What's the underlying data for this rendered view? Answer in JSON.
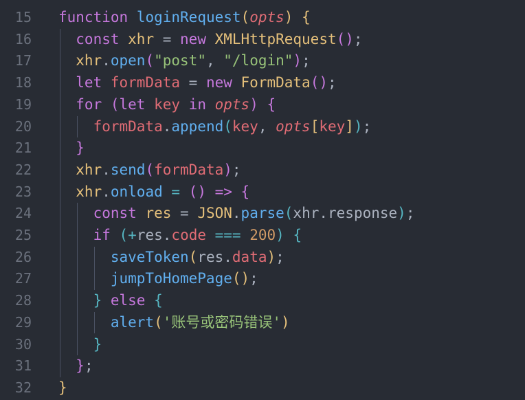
{
  "editor": {
    "lines": [
      {
        "num": "15",
        "tokens": [
          {
            "t": "function",
            "c": "kw"
          },
          {
            "t": " ",
            "c": "tx"
          },
          {
            "t": "loginRequest",
            "c": "fn"
          },
          {
            "t": "(",
            "c": "br"
          },
          {
            "t": "opts",
            "c": "pa"
          },
          {
            "t": ")",
            "c": "br"
          },
          {
            "t": " ",
            "c": "tx"
          },
          {
            "t": "{",
            "c": "br"
          }
        ]
      },
      {
        "num": "16",
        "tokens": [
          {
            "t": "  const ",
            "c": "kw"
          },
          {
            "t": "xhr",
            "c": "va"
          },
          {
            "t": " = ",
            "c": "tx"
          },
          {
            "t": "new ",
            "c": "kw"
          },
          {
            "t": "XMLHttpRequest",
            "c": "cl"
          },
          {
            "t": "()",
            "c": "pn"
          },
          {
            "t": ";",
            "c": "tx"
          }
        ]
      },
      {
        "num": "17",
        "tokens": [
          {
            "t": "  xhr",
            "c": "va"
          },
          {
            "t": ".",
            "c": "tx"
          },
          {
            "t": "open",
            "c": "fn"
          },
          {
            "t": "(",
            "c": "pn"
          },
          {
            "t": "\"post\"",
            "c": "st"
          },
          {
            "t": ", ",
            "c": "tx"
          },
          {
            "t": "\"/login\"",
            "c": "st"
          },
          {
            "t": ")",
            "c": "pn"
          },
          {
            "t": ";",
            "c": "tx"
          }
        ]
      },
      {
        "num": "18",
        "tokens": [
          {
            "t": "  let ",
            "c": "kw"
          },
          {
            "t": "formData",
            "c": "vr"
          },
          {
            "t": " = ",
            "c": "tx"
          },
          {
            "t": "new ",
            "c": "kw"
          },
          {
            "t": "FormData",
            "c": "cl"
          },
          {
            "t": "()",
            "c": "pn"
          },
          {
            "t": ";",
            "c": "tx"
          }
        ]
      },
      {
        "num": "19",
        "tokens": [
          {
            "t": "  for ",
            "c": "kw"
          },
          {
            "t": "(",
            "c": "pn"
          },
          {
            "t": "let ",
            "c": "kw"
          },
          {
            "t": "key",
            "c": "vr"
          },
          {
            "t": " in ",
            "c": "kw"
          },
          {
            "t": "opts",
            "c": "pa"
          },
          {
            "t": ")",
            "c": "pn"
          },
          {
            "t": " ",
            "c": "tx"
          },
          {
            "t": "{",
            "c": "pn"
          }
        ]
      },
      {
        "num": "20",
        "tokens": [
          {
            "t": "    formData",
            "c": "vr"
          },
          {
            "t": ".",
            "c": "tx"
          },
          {
            "t": "append",
            "c": "fn"
          },
          {
            "t": "(",
            "c": "sq"
          },
          {
            "t": "key",
            "c": "vr"
          },
          {
            "t": ", ",
            "c": "tx"
          },
          {
            "t": "opts",
            "c": "pa"
          },
          {
            "t": "[",
            "c": "br"
          },
          {
            "t": "key",
            "c": "vr"
          },
          {
            "t": "]",
            "c": "br"
          },
          {
            "t": ")",
            "c": "sq"
          },
          {
            "t": ";",
            "c": "tx"
          }
        ]
      },
      {
        "num": "21",
        "tokens": [
          {
            "t": "  }",
            "c": "pn"
          }
        ]
      },
      {
        "num": "22",
        "tokens": [
          {
            "t": "  xhr",
            "c": "va"
          },
          {
            "t": ".",
            "c": "tx"
          },
          {
            "t": "send",
            "c": "fn"
          },
          {
            "t": "(",
            "c": "pn"
          },
          {
            "t": "formData",
            "c": "vr"
          },
          {
            "t": ")",
            "c": "pn"
          },
          {
            "t": ";",
            "c": "tx"
          }
        ]
      },
      {
        "num": "23",
        "tokens": [
          {
            "t": "  xhr",
            "c": "va"
          },
          {
            "t": ".",
            "c": "tx"
          },
          {
            "t": "onload",
            "c": "fn"
          },
          {
            "t": " = ",
            "c": "op"
          },
          {
            "t": "()",
            "c": "pn"
          },
          {
            "t": " => ",
            "c": "kw"
          },
          {
            "t": "{",
            "c": "pn"
          }
        ]
      },
      {
        "num": "24",
        "tokens": [
          {
            "t": "    const ",
            "c": "kw"
          },
          {
            "t": "res",
            "c": "va"
          },
          {
            "t": " = ",
            "c": "tx"
          },
          {
            "t": "JSON",
            "c": "cl"
          },
          {
            "t": ".",
            "c": "tx"
          },
          {
            "t": "parse",
            "c": "fn"
          },
          {
            "t": "(",
            "c": "sq"
          },
          {
            "t": "xhr",
            "c": "tx"
          },
          {
            "t": ".",
            "c": "tx"
          },
          {
            "t": "response",
            "c": "tx"
          },
          {
            "t": ")",
            "c": "sq"
          },
          {
            "t": ";",
            "c": "tx"
          }
        ]
      },
      {
        "num": "25",
        "tokens": [
          {
            "t": "    if ",
            "c": "kw"
          },
          {
            "t": "(",
            "c": "sq"
          },
          {
            "t": "+",
            "c": "op"
          },
          {
            "t": "res",
            "c": "tx"
          },
          {
            "t": ".",
            "c": "tx"
          },
          {
            "t": "code",
            "c": "pr"
          },
          {
            "t": " === ",
            "c": "op"
          },
          {
            "t": "200",
            "c": "nm"
          },
          {
            "t": ")",
            "c": "sq"
          },
          {
            "t": " ",
            "c": "tx"
          },
          {
            "t": "{",
            "c": "sq"
          }
        ]
      },
      {
        "num": "26",
        "tokens": [
          {
            "t": "      saveToken",
            "c": "fn"
          },
          {
            "t": "(",
            "c": "br"
          },
          {
            "t": "res",
            "c": "tx"
          },
          {
            "t": ".",
            "c": "tx"
          },
          {
            "t": "data",
            "c": "pr"
          },
          {
            "t": ")",
            "c": "br"
          },
          {
            "t": ";",
            "c": "tx"
          }
        ]
      },
      {
        "num": "27",
        "tokens": [
          {
            "t": "      jumpToHomePage",
            "c": "fn"
          },
          {
            "t": "()",
            "c": "br"
          },
          {
            "t": ";",
            "c": "tx"
          }
        ]
      },
      {
        "num": "28",
        "tokens": [
          {
            "t": "    }",
            "c": "sq"
          },
          {
            "t": " else ",
            "c": "kw"
          },
          {
            "t": "{",
            "c": "sq"
          }
        ]
      },
      {
        "num": "29",
        "tokens": [
          {
            "t": "      alert",
            "c": "fn"
          },
          {
            "t": "(",
            "c": "br"
          },
          {
            "t": "'账号或密码错误'",
            "c": "st"
          },
          {
            "t": ")",
            "c": "br"
          }
        ]
      },
      {
        "num": "30",
        "tokens": [
          {
            "t": "    }",
            "c": "sq"
          }
        ]
      },
      {
        "num": "31",
        "tokens": [
          {
            "t": "  }",
            "c": "pn"
          },
          {
            "t": ";",
            "c": "tx"
          }
        ]
      },
      {
        "num": "32",
        "tokens": [
          {
            "t": "}",
            "c": "br"
          }
        ]
      }
    ]
  },
  "colors": {
    "background": "#282c34",
    "line_number": "#6b717d",
    "keyword": "#c678dd",
    "function": "#61afef",
    "string": "#98c379",
    "number": "#d19a66",
    "property": "#e06c75",
    "class": "#e5c07b"
  }
}
